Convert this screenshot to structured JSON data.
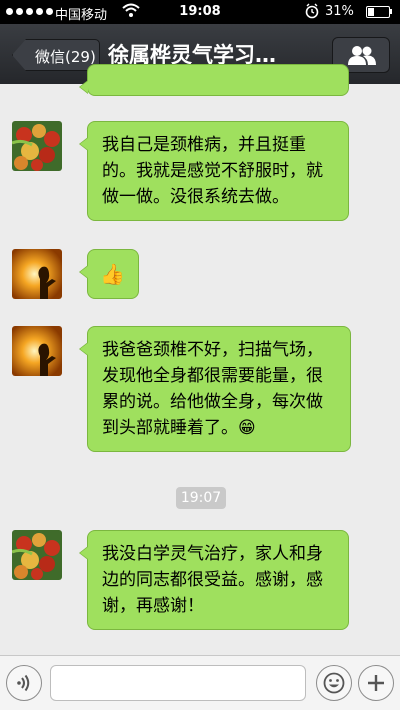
{
  "status_bar": {
    "carrier": "中国移动",
    "time": "19:08",
    "battery_text": "31%",
    "battery_level": 0.31
  },
  "nav": {
    "back_label": "微信(29)",
    "title": "徐属桦灵气学习…"
  },
  "messages": [
    {
      "id": "m0",
      "avatar": "fruit-avatar",
      "text": ""
    },
    {
      "id": "m1",
      "avatar": "fruit-avatar",
      "text": "我自己是颈椎病，并且挺重的。我就是感觉不舒服时，就做一做。没很系统去做。"
    },
    {
      "id": "m2",
      "avatar": "sunset-avatar",
      "text": "👍"
    },
    {
      "id": "m3",
      "avatar": "sunset-avatar",
      "text": "我爸爸颈椎不好，扫描气场，发现他全身都很需要能量，很累的说。给他做全身，每次做到头部就睡着了。😁"
    },
    {
      "id": "m4",
      "avatar": "fruit-avatar",
      "text": "我没白学灵气治疗，家人和身边的同志都很受益。感谢，感谢，再感谢！"
    }
  ],
  "timestamp": "19:07",
  "input_bar": {
    "voice_icon": "voice-icon",
    "text_value": "",
    "emoji_icon": "emoji-icon",
    "plus_icon": "plus-icon"
  },
  "colors": {
    "bubble": "#9fe05e",
    "nav": "#2f3236",
    "background": "#ececec"
  }
}
